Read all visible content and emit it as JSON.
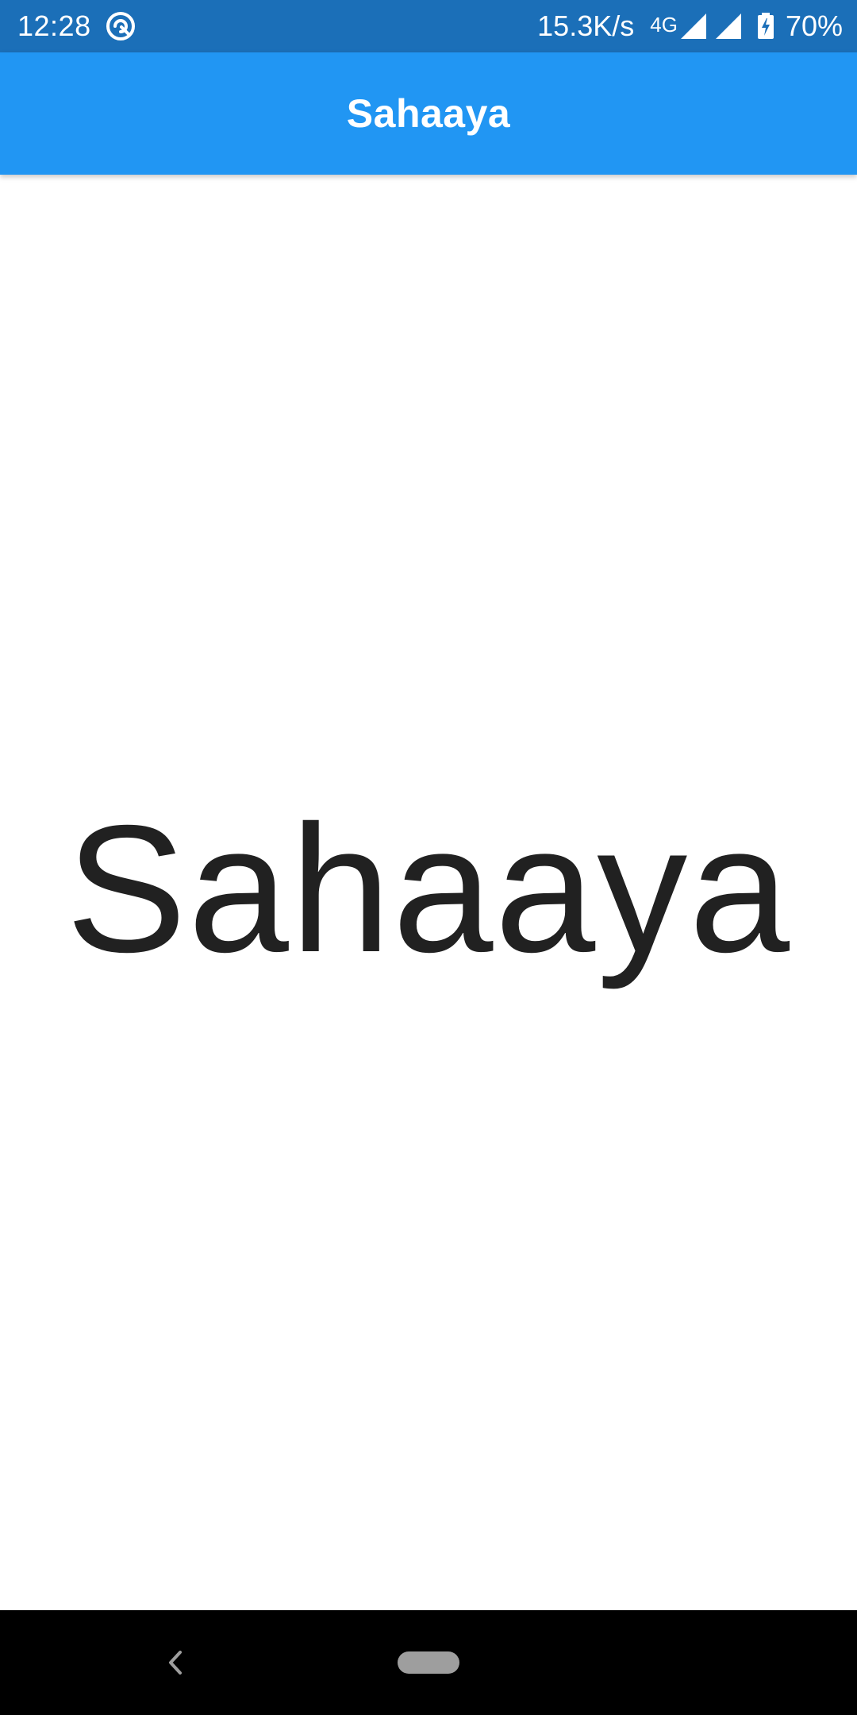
{
  "status_bar": {
    "time": "12:28",
    "net_speed": "15.3K/s",
    "net_type": "4G",
    "battery_percent": "70%",
    "icons": [
      "app-notification-icon",
      "signal-icon",
      "signal-icon",
      "battery-charging-icon"
    ]
  },
  "app_bar": {
    "title": "Sahaaya",
    "color": "#2196f3"
  },
  "main": {
    "hero_text": "Sahaaya"
  },
  "nav_bar": {
    "icons": [
      "back-icon",
      "home-pill-icon"
    ]
  },
  "colors": {
    "status_bar": "#1b6fb8",
    "app_bar": "#2196f3",
    "text": "#212121",
    "nav_bar": "#000000"
  }
}
